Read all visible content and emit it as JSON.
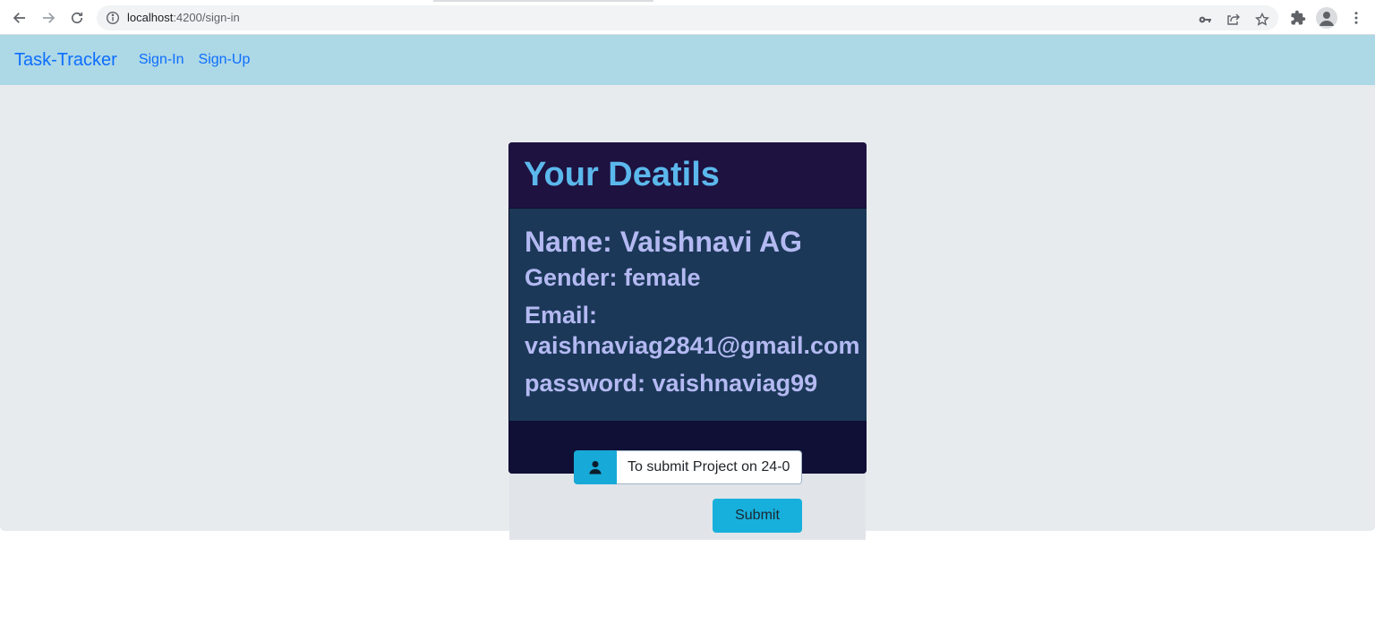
{
  "browser": {
    "url_host": "localhost",
    "url_path": ":4200/sign-in"
  },
  "navbar": {
    "brand": "Task-Tracker",
    "links": [
      {
        "label": "Sign-In"
      },
      {
        "label": "Sign-Up"
      }
    ]
  },
  "details_card": {
    "title": "Your Deatils",
    "name": "Name: Vaishnavi AG",
    "gender": "Gender: female",
    "email_label": "Email:",
    "email_value": "vaishnaviag2841@gmail.com",
    "password": "password: vaishnaviag99"
  },
  "task_form": {
    "input_value": "To submit Project on 24-0",
    "submit_label": "Submit"
  },
  "icons": {
    "back": "back-arrow-icon",
    "forward": "forward-arrow-icon",
    "reload": "reload-icon",
    "info": "info-icon",
    "key": "key-icon",
    "share": "share-icon",
    "star": "star-icon",
    "extensions": "puzzle-icon",
    "profile": "profile-icon",
    "menu": "kebab-menu-icon",
    "user": "user-icon"
  },
  "colors": {
    "navbar_bg": "#add8e6",
    "link": "#0d6efd",
    "card_header_bg": "#1e1240",
    "card_body_bg": "#1b3858",
    "title": "#5bb8ec",
    "detail_text": "#b4b9f2",
    "accent": "#17b0dc"
  }
}
